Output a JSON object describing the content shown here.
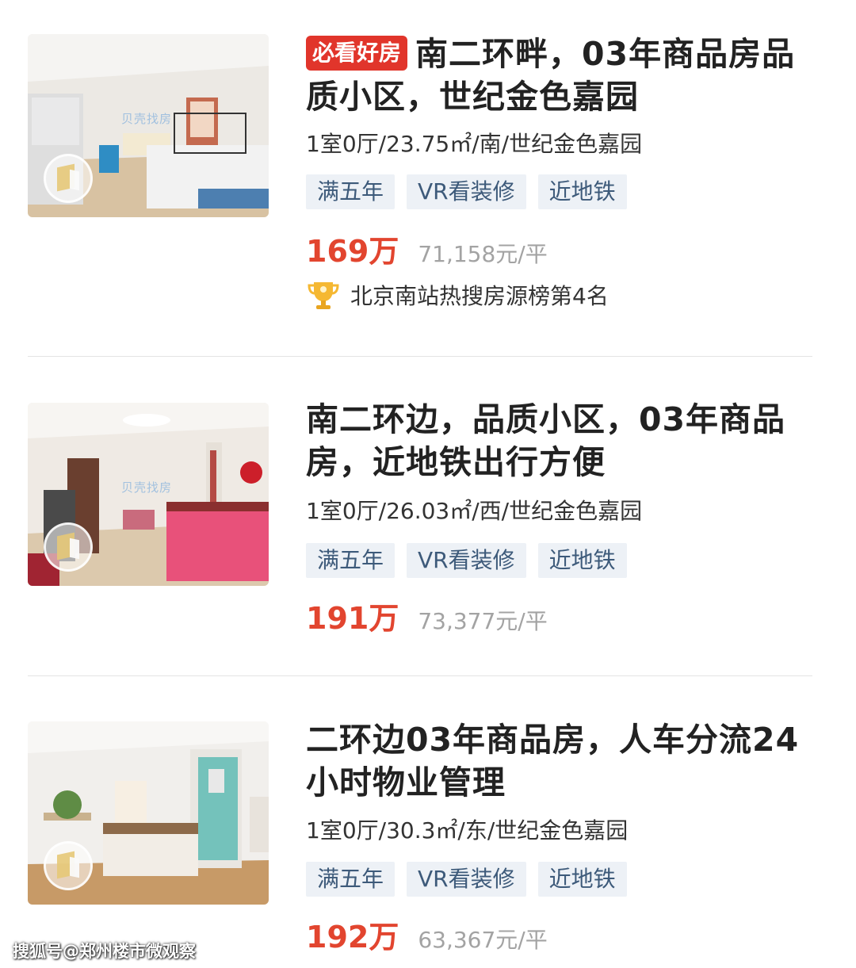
{
  "listings": [
    {
      "badge": "必看好房",
      "title": "南二环畔，03年商品房品质小区，世纪金色嘉园",
      "attributes": "1室0厅/23.75㎡/南/世纪金色嘉园",
      "tags": [
        "满五年",
        "VR看装修",
        "近地铁"
      ],
      "price": "169万",
      "unit_price": "71,158元/平",
      "ranking": "北京南站热搜房源榜第4名",
      "watermark": "贝壳找房"
    },
    {
      "title": "南二环边，品质小区，03年商品房，近地铁出行方便",
      "attributes": "1室0厅/26.03㎡/西/世纪金色嘉园",
      "tags": [
        "满五年",
        "VR看装修",
        "近地铁"
      ],
      "price": "191万",
      "unit_price": "73,377元/平",
      "watermark": "贝壳找房"
    },
    {
      "title": "二环边03年商品房，人车分流24小时物业管理",
      "attributes": "1室0厅/30.3㎡/东/世纪金色嘉园",
      "tags": [
        "满五年",
        "VR看装修",
        "近地铁"
      ],
      "price": "192万",
      "unit_price": "63,367元/平"
    }
  ],
  "footer": "搜狐号@郑州楼市微观察",
  "colors": {
    "badge": "#e1352b",
    "price": "#e2452f",
    "tag_bg": "#edf1f6",
    "tag_text": "#3d5a7a",
    "unit_price": "#a3a3a3"
  }
}
